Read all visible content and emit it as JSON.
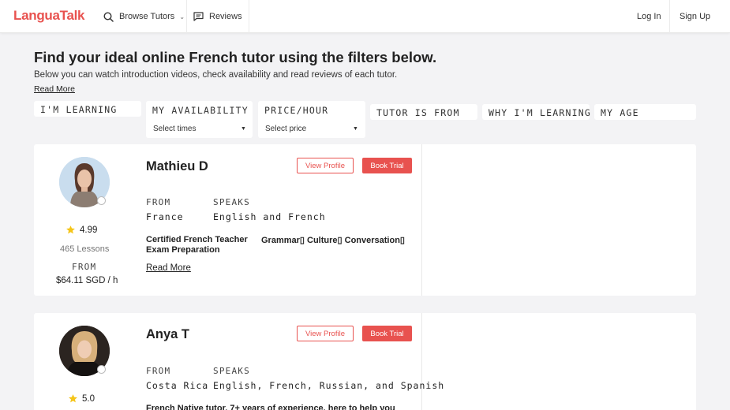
{
  "header": {
    "logo": "LanguaTalk",
    "browse_tutors": "Browse Tutors",
    "reviews": "Reviews",
    "login": "Log In",
    "signup": "Sign Up"
  },
  "main": {
    "title": "Find your ideal online French tutor using the filters below.",
    "subtitle": "Below you can watch introduction videos, check availability and read reviews of each tutor.",
    "read_more": "Read More"
  },
  "filters": [
    {
      "label": "I'M LEARNING"
    },
    {
      "label": "MY AVAILABILITY",
      "value": "Select times"
    },
    {
      "label": "PRICE/HOUR",
      "value": "Select price"
    },
    {
      "label": "TUTOR IS FROM"
    },
    {
      "label": "WHY I'M LEARNING"
    },
    {
      "label": "MY AGE"
    }
  ],
  "tutors": [
    {
      "name": "Mathieu D",
      "view_profile": "View Profile",
      "book_trial": "Book Trial",
      "from_label": "FROM",
      "from": "France",
      "speaks_label": "SPEAKS",
      "speaks": "English and French",
      "rating": "4.99",
      "lessons": "465 Lessons",
      "price_from_label": "FROM",
      "price": "$64.11 SGD / h",
      "headline_line1": "Certified French Teacher",
      "headline_line2": "Exam Preparation",
      "tags": "Grammar▯ Culture▯ Conversation▯",
      "read_more": "Read More"
    },
    {
      "name": "Anya T",
      "view_profile": "View Profile",
      "book_trial": "Book Trial",
      "from_label": "FROM",
      "from": "Costa Rica",
      "speaks_label": "SPEAKS",
      "speaks": "English, French, Russian, and Spanish",
      "rating": "5.0",
      "headline_line1": "French Native tutor, 7+ years of experience, here to help you"
    }
  ],
  "colors": {
    "brand": "#e8524f",
    "background": "#f3f3f5",
    "star": "#f5c518"
  }
}
